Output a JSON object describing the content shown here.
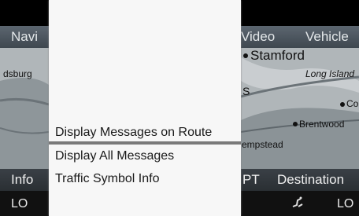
{
  "topbar": {
    "left": "Navi",
    "video": "Video",
    "vehicle": "Vehicle"
  },
  "bottombar": {
    "info": "Info",
    "pt": "PT",
    "destination": "Destination"
  },
  "statusbar": {
    "lo_left": "LO",
    "lo_right": "LO",
    "climate_icon": "seat-fan-icon"
  },
  "map": {
    "labels": {
      "stamford": "Stamford",
      "long_island": "Long Island",
      "co": "Co",
      "brentwood": "Brentwood",
      "empstead": "empstead",
      "dsburg": "dsburg",
      "s": "S"
    }
  },
  "menu": {
    "items": [
      {
        "label": "Display Messages on Route",
        "selected": true
      },
      {
        "label": "Display All Messages",
        "selected": false
      },
      {
        "label": "Traffic Symbol Info",
        "selected": false
      }
    ]
  }
}
